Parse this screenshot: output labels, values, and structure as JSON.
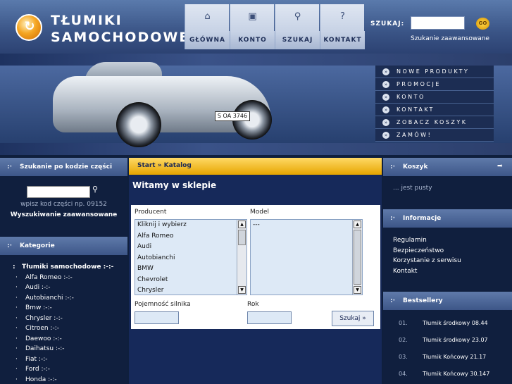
{
  "logo": {
    "line1": "TŁUMIKI",
    "line2": "SAMOCHODOWE",
    "mark": "↻"
  },
  "nav": [
    {
      "label": "GŁÓWNA",
      "icon": "home-icon",
      "glyph": "⌂"
    },
    {
      "label": "KONTO",
      "icon": "account-icon",
      "glyph": "▣"
    },
    {
      "label": "SZUKAJ",
      "icon": "search-icon",
      "glyph": "⚲"
    },
    {
      "label": "KONTAKT",
      "icon": "help-icon",
      "glyph": "?"
    }
  ],
  "search": {
    "label": "SZUKAJ:",
    "value": "",
    "go_label": "GO",
    "advanced": "Szukanie zaawansowane"
  },
  "hero": {
    "plate": "S OA 3746",
    "menu": [
      "NOWE PRODUKTY",
      "PROMOCJE",
      "KONTO",
      "KONTAKT",
      "ZOBACZ KOSZYK",
      "ZAMÓW!"
    ],
    "bullet": "»"
  },
  "left": {
    "code_search": {
      "title": "Szukanie po kodzie części",
      "value": "",
      "hint": "wpisz kod części np. 09152",
      "advanced": "Wyszukiwanie zaawansowane"
    },
    "categories": {
      "title": "Kategorie",
      "items": [
        {
          "label": "Tłumiki samochodowe :-:-",
          "top": true
        },
        {
          "label": "Alfa Romeo :-:-"
        },
        {
          "label": "Audi :-:-"
        },
        {
          "label": "Autobianchi :-:-"
        },
        {
          "label": "Bmw :-:-"
        },
        {
          "label": "Chrysler :-:-"
        },
        {
          "label": "Citroen :-:-"
        },
        {
          "label": "Daewoo :-:-"
        },
        {
          "label": "Daihatsu :-:-"
        },
        {
          "label": "Fiat :-:-"
        },
        {
          "label": "Ford :-:-"
        },
        {
          "label": "Honda :-:-"
        }
      ]
    }
  },
  "center": {
    "breadcrumb": "Start » Katalog",
    "welcome": "Witamy w sklepie",
    "form": {
      "producer_label": "Producent",
      "model_label": "Model",
      "producers": [
        "Kliknij i wybierz",
        "Alfa Romeo",
        "Audi",
        "Autobianchi",
        "BMW",
        "Chevrolet",
        "Chrysler"
      ],
      "models": [
        "---"
      ],
      "engine_label": "Pojemność silnika",
      "year_label": "Rok",
      "engine_value": "",
      "year_value": "",
      "submit": "Szukaj »"
    }
  },
  "right": {
    "cart": {
      "title": "Koszyk",
      "empty": "... jest pusty",
      "arrow": "➡"
    },
    "info": {
      "title": "Informacje",
      "items": [
        "Regulamin",
        "Bezpieczeństwo",
        "Korzystanie z serwisu",
        "Kontakt"
      ]
    },
    "bestsellers": {
      "title": "Bestsellery",
      "items": [
        {
          "n": "01.",
          "t": "Tłumik środkowy 08.44"
        },
        {
          "n": "02.",
          "t": "Tłumik środkowy 23.07"
        },
        {
          "n": "03.",
          "t": "Tłumik Końcowy 21.17"
        },
        {
          "n": "04.",
          "t": "Tłumik Końcowy 30.147"
        }
      ]
    }
  }
}
